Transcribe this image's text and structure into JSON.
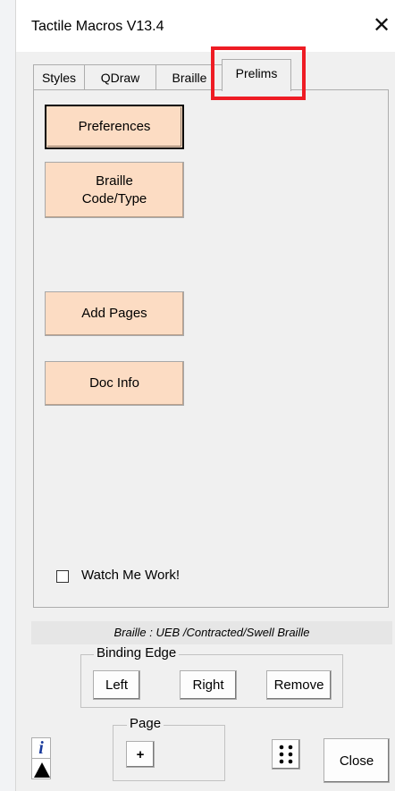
{
  "window": {
    "title": "Tactile Macros V13.4",
    "close_glyph": "✕"
  },
  "tabs": [
    {
      "label": "Styles",
      "active": false
    },
    {
      "label": "QDraw",
      "active": false
    },
    {
      "label": "Braille",
      "active": false
    },
    {
      "label": "Prelims",
      "active": true
    }
  ],
  "prelims": {
    "preferences_label": "Preferences",
    "braille_code_label": "Braille\nCode/Type",
    "add_pages_label": "Add Pages",
    "doc_info_label": "Doc Info",
    "watch_me_work_label": "Watch Me Work!",
    "watch_me_work_checked": false
  },
  "status": {
    "text": "Braille : UEB /Contracted/Swell Braille"
  },
  "binding_edge": {
    "legend": "Binding Edge",
    "left_label": "Left",
    "right_label": "Right",
    "remove_label": "Remove"
  },
  "page_group": {
    "legend": "Page",
    "plus_label": "+"
  },
  "footer": {
    "info_glyph": "i",
    "close_label": "Close"
  },
  "colors": {
    "accent_button": "#fcdcc3",
    "highlight_box": "#ee1c24"
  },
  "icons": [
    "close-icon",
    "info-icon",
    "triangle-up-icon",
    "braille-dots-icon"
  ]
}
